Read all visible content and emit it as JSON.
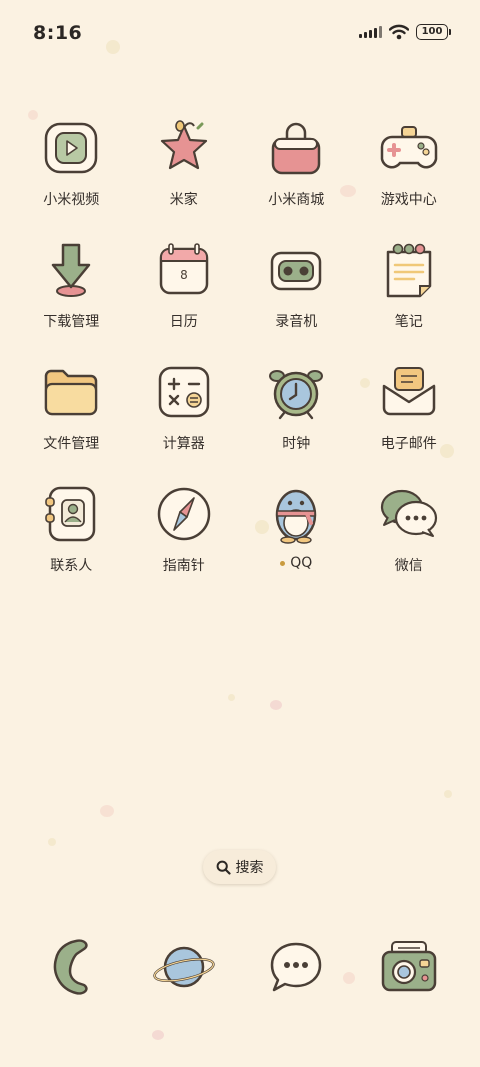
{
  "status_bar": {
    "time": "8:16",
    "battery": "100"
  },
  "apps": [
    {
      "label": "小米视频",
      "icon": "video-play-icon",
      "name": "app-mi-video"
    },
    {
      "label": "米家",
      "icon": "star-icon",
      "name": "app-mijia"
    },
    {
      "label": "小米商城",
      "icon": "shopping-bag-icon",
      "name": "app-mi-store"
    },
    {
      "label": "游戏中心",
      "icon": "gamepad-icon",
      "name": "app-game-center"
    },
    {
      "label": "下载管理",
      "icon": "download-arrow-icon",
      "name": "app-downloads"
    },
    {
      "label": "日历",
      "icon": "calendar-icon",
      "name": "app-calendar",
      "day": "8"
    },
    {
      "label": "录音机",
      "icon": "recorder-icon",
      "name": "app-recorder"
    },
    {
      "label": "笔记",
      "icon": "notepad-icon",
      "name": "app-notes"
    },
    {
      "label": "文件管理",
      "icon": "folder-icon",
      "name": "app-file-manager"
    },
    {
      "label": "计算器",
      "icon": "calculator-icon",
      "name": "app-calculator"
    },
    {
      "label": "时钟",
      "icon": "alarm-clock-icon",
      "name": "app-clock"
    },
    {
      "label": "电子邮件",
      "icon": "envelope-icon",
      "name": "app-email"
    },
    {
      "label": "联系人",
      "icon": "contacts-book-icon",
      "name": "app-contacts"
    },
    {
      "label": "指南针",
      "icon": "compass-icon",
      "name": "app-compass"
    },
    {
      "label": "QQ",
      "icon": "penguin-icon",
      "name": "app-qq",
      "new_dot": true
    },
    {
      "label": "微信",
      "icon": "chat-bubbles-icon",
      "name": "app-wechat"
    }
  ],
  "search": {
    "label": "搜索"
  },
  "dock": [
    {
      "icon": "phone-handset-icon",
      "name": "dock-phone"
    },
    {
      "icon": "planet-icon",
      "name": "dock-browser"
    },
    {
      "icon": "message-bubble-icon",
      "name": "dock-messages"
    },
    {
      "icon": "camera-icon",
      "name": "dock-camera"
    }
  ],
  "colors": {
    "background": "#fbf2e2",
    "outline": "#4a3f36",
    "green": "#9bb08a",
    "pink": "#e69393",
    "cream": "#fff7ea",
    "yellow": "#f5d596",
    "blue": "#a9c6dd"
  }
}
